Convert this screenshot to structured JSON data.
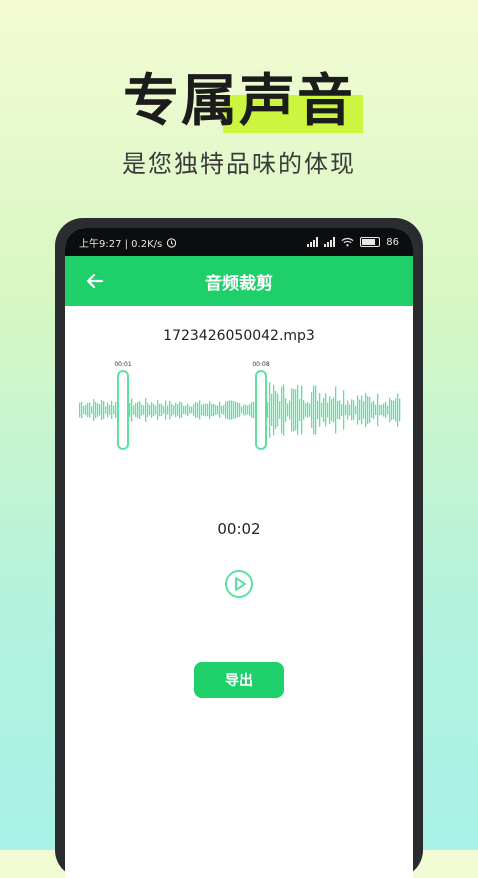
{
  "promo": {
    "headline": "专属声音",
    "subline": "是您独特品味的体现",
    "accent_color": "#cbf53f"
  },
  "status_bar": {
    "time_speed": "上午9:27 | 0.2K/s",
    "battery": "86"
  },
  "app_bar": {
    "title": "音频裁剪",
    "color": "#1fd06a"
  },
  "editor": {
    "filename": "1723426050042.mp3",
    "handle_start_time": "00:01",
    "handle_end_time": "00:08",
    "current_time": "00:02",
    "export_label": "导出",
    "wave_color": "#5fe0a0"
  },
  "icons": [
    "back-arrow-icon",
    "play-icon",
    "alarm-icon",
    "signal-icon",
    "wifi-icon",
    "battery-icon"
  ]
}
